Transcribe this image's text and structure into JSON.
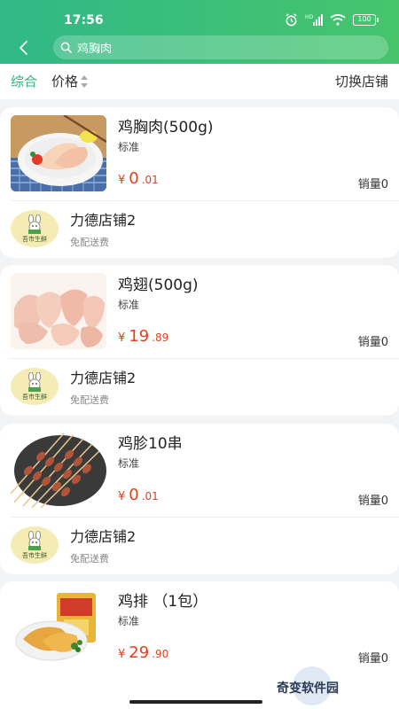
{
  "status_bar": {
    "time": "17:56",
    "battery": "100"
  },
  "search": {
    "query": "鸡胸肉"
  },
  "filters": {
    "all": "综合",
    "price": "价格",
    "switch_shop": "切换店铺"
  },
  "products": [
    {
      "name": "鸡胸肉(500g)",
      "spec": "标准",
      "currency": "¥",
      "price_int": "0",
      "price_dec": ".01",
      "sales": "销量0",
      "shop": {
        "name": "力德店铺2",
        "delivery": "免配送费",
        "logo_text": "吾市生鲜"
      }
    },
    {
      "name": "鸡翅(500g)",
      "spec": "标准",
      "currency": "¥",
      "price_int": "19",
      "price_dec": ".89",
      "sales": "销量0",
      "shop": {
        "name": "力德店铺2",
        "delivery": "免配送费",
        "logo_text": "吾市生鲜"
      }
    },
    {
      "name": "鸡胗10串",
      "spec": "标准",
      "currency": "¥",
      "price_int": "0",
      "price_dec": ".01",
      "sales": "销量0",
      "shop": {
        "name": "力德店铺2",
        "delivery": "免配送费",
        "logo_text": "吾市生鲜"
      }
    },
    {
      "name": "鸡排 （1包）",
      "spec": "标准",
      "currency": "¥",
      "price_int": "29",
      "price_dec": ".90",
      "sales": "销量0"
    }
  ],
  "watermark": "奇变软件园",
  "colors": {
    "primary": "#2fb37c",
    "price": "#e0401e"
  },
  "icons": [
    "alarm-icon",
    "signal-icon",
    "wifi-icon",
    "battery-icon",
    "back-icon",
    "search-icon",
    "sort-arrows-icon"
  ]
}
